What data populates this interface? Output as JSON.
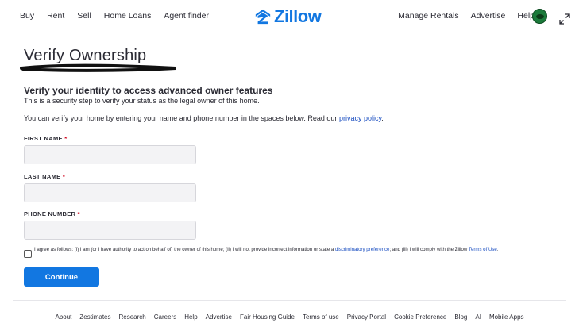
{
  "nav": {
    "left": [
      "Buy",
      "Rent",
      "Sell",
      "Home Loans",
      "Agent finder"
    ],
    "right": [
      "Manage Rentals",
      "Advertise",
      "Help"
    ],
    "logo_text": "Zillow",
    "brand_color": "#1277e1",
    "avatar_icon": "user-avatar-icon",
    "expand_icon": "expand-arrows-icon"
  },
  "page": {
    "title": "Verify Ownership",
    "heading": "Verify your identity to access advanced owner features",
    "subtext": "This is a security step to verify your status as the legal owner of this home.",
    "intro": "You can verify your home by entering your name and phone number in the spaces below. Read our",
    "privacy_link": "privacy policy",
    "intro_end": "."
  },
  "form": {
    "first_name": {
      "label": "FIRST NAME",
      "required": "*",
      "value": ""
    },
    "last_name": {
      "label": "LAST NAME",
      "required": "*",
      "value": ""
    },
    "phone": {
      "label": "PHONE NUMBER",
      "required": "*",
      "value": ""
    },
    "agree": {
      "checked": false,
      "text_1": "I agree as follows: (i) I am (or I have authority to act on behalf of) the owner of this home; (ii) I will not provide incorrect information or state a",
      "link_1": "discriminatory preference",
      "text_2": "; and (iii) I will comply with the Zillow",
      "link_2": "Terms of Use",
      "text_3": "."
    },
    "continue_label": "Continue"
  },
  "footer": [
    "About",
    "Zestimates",
    "Research",
    "Careers",
    "Help",
    "Advertise",
    "Fair Housing Guide",
    "Terms of use",
    "Privacy Portal",
    "Cookie Preference",
    "Blog",
    "AI",
    "Mobile Apps"
  ]
}
